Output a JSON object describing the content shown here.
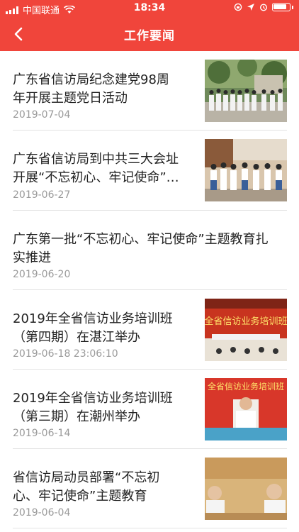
{
  "status_bar": {
    "carrier": "中国联通",
    "time": "18:34"
  },
  "nav": {
    "title": "工作要闻",
    "back_icon": "chevron-left-icon"
  },
  "news": [
    {
      "title_line1": "广东省信访局纪念建党98周",
      "title_line2": "年开展主题党日活动",
      "date": "2019-07-04",
      "has_thumbnail": true
    },
    {
      "title_line1": "广东省信访局到中共三大会址",
      "title_line2": "开展“不忘初心、牢记使命”…",
      "date": "2019-06-27",
      "has_thumbnail": true
    },
    {
      "title_line1": "广东第一批“不忘初心、牢记使命”主题教育扎",
      "title_line2": "实推进",
      "date": "2019-06-20",
      "has_thumbnail": false
    },
    {
      "title_line1": "2019年全省信访业务培训班",
      "title_line2": "（第四期）在湛江举办",
      "date": "2019-06-18 23:06:10",
      "has_thumbnail": true,
      "thumb_text": "全省信访业务培训班"
    },
    {
      "title_line1": "2019年全省信访业务培训班",
      "title_line2": "（第三期）在潮州举办",
      "date": "2019-06-14",
      "has_thumbnail": true,
      "thumb_text": "全省信访业务培训班"
    },
    {
      "title_line1": "省信访局动员部署“不忘初",
      "title_line2": "心、牢记使命”主题教育",
      "date": "2019-06-04",
      "has_thumbnail": true
    }
  ],
  "colors": {
    "header": "#f0453b",
    "date": "#9a9a9a",
    "divider": "#e3e3e3"
  }
}
